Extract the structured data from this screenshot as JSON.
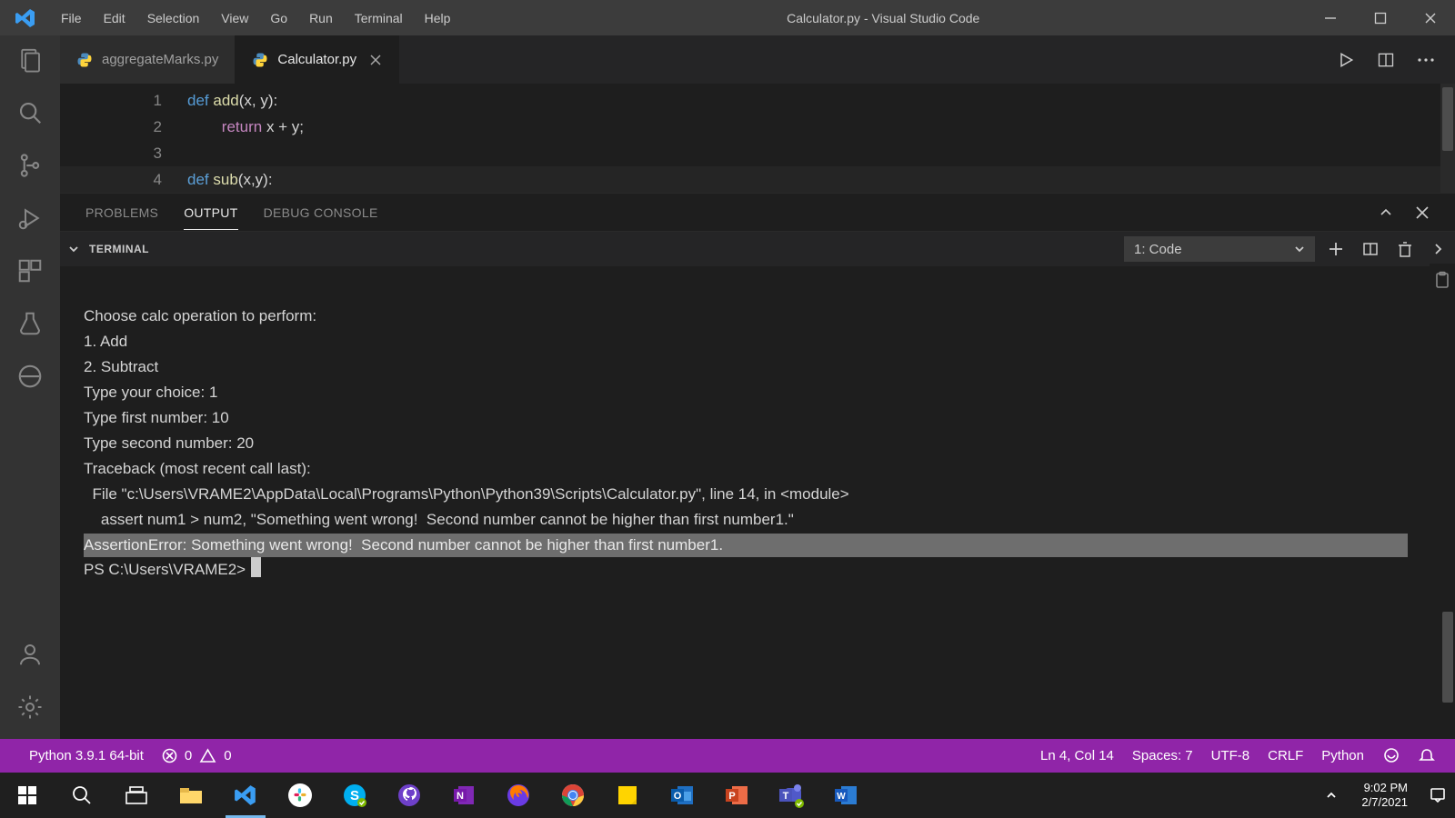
{
  "titlebar": {
    "menus": [
      "File",
      "Edit",
      "Selection",
      "View",
      "Go",
      "Run",
      "Terminal",
      "Help"
    ],
    "title": "Calculator.py - Visual Studio Code"
  },
  "tabs": [
    {
      "label": "aggregateMarks.py",
      "active": false
    },
    {
      "label": "Calculator.py",
      "active": true
    }
  ],
  "editor": {
    "line_numbers": [
      "1",
      "2",
      "3",
      "4"
    ],
    "lines": {
      "l1_def": "def ",
      "l1_fn": "add",
      "l1_rest": "(x, y):",
      "l2_indent": "        ",
      "l2_ret": "return ",
      "l2_rest": "x + y;",
      "l3": "",
      "l4_def": "def ",
      "l4_fn": "sub",
      "l4_rest": "(x,y):"
    }
  },
  "panel_tabs": {
    "problems": "PROBLEMS",
    "output": "OUTPUT",
    "debug": "DEBUG CONSOLE"
  },
  "terminal": {
    "header_label": "TERMINAL",
    "picker": "1: Code",
    "lines": {
      "l1": "Choose calc operation to perform:",
      "l2": "1. Add",
      "l3": "2. Subtract",
      "l4": "Type your choice: 1",
      "l5": "Type first number: 10",
      "l6": "Type second number: 20",
      "l7": "Traceback (most recent call last):",
      "l8": "  File \"c:\\Users\\VRAME2\\AppData\\Local\\Programs\\Python\\Python39\\Scripts\\Calculator.py\", line 14, in <module>",
      "l9": "    assert num1 > num2, \"Something went wrong!  Second number cannot be higher than first number1.\"",
      "err": "AssertionError: Something went wrong!  Second number cannot be higher than first number1.",
      "prompt": "PS C:\\Users\\VRAME2>"
    }
  },
  "status": {
    "python": "Python 3.9.1 64-bit",
    "errors": "0",
    "warnings": "0",
    "lncol": "Ln 4, Col 14",
    "spaces": "Spaces: 7",
    "enc": "UTF-8",
    "eol": "CRLF",
    "lang": "Python"
  },
  "taskbar": {
    "time": "9:02 PM",
    "date": "2/7/2021"
  }
}
